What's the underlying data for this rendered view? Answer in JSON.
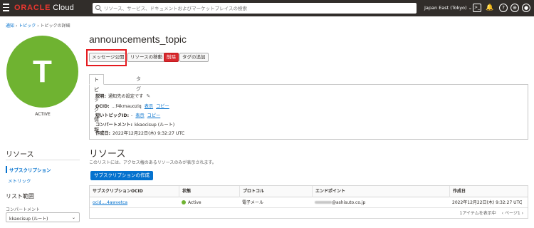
{
  "header": {
    "brand": "ORACLE",
    "product": "Cloud",
    "search_placeholder": "リソース、サービス、ドキュメントおよびマーケットプレイスの検索",
    "region": "Japan East (Tokyo)",
    "region_chevron": "⌄"
  },
  "breadcrumb": {
    "items": [
      "通知",
      "トピック",
      "トピックの詳細"
    ],
    "sep": "›"
  },
  "avatar": {
    "letter": "T",
    "status": "ACTIVE",
    "color": "#6fb331"
  },
  "left_nav": {
    "heading": "リソース",
    "items": [
      "サブスクリプション",
      "メトリック"
    ],
    "scope_heading": "リスト範囲",
    "compartment_label": "コンパートメント",
    "compartment_value": "kkaocisup (ルート)",
    "compartment_chevron": "⌄"
  },
  "main": {
    "title": "announcements_topic",
    "actions": {
      "publish": "メッセージ公開",
      "move": "リソースの移動",
      "delete": "削除",
      "add_tag": "タグの追加"
    },
    "tabs": [
      "トピック情報",
      "タグ"
    ],
    "info": {
      "desc_label": "説明:",
      "desc_value": "通知先の設定です",
      "ocid_label": "OCID:",
      "ocid_value": "...f4kmauoziq",
      "show": "表示",
      "copy": "コピー",
      "short_ocid_label": "短いトピックID:",
      "short_ocid_value": "-",
      "compartment_label": "コンパートメント:",
      "compartment_value": "kkaocisup (ルート)",
      "created_label": "作成日:",
      "created_value": "2022年12月22日(木) 9:32:27 UTC"
    },
    "resources_title": "リソース",
    "resources_desc": "このリストには、アクセス権のあるリソースのみが表示されます。",
    "create_button": "サブスクリプションの作成",
    "table": {
      "headers": [
        "サブスクリプションOCID",
        "状態",
        "プロトコル",
        "エンドポイント",
        "作成日"
      ],
      "rows": [
        {
          "ocid": "ocid....4awvetca",
          "status": "Active",
          "protocol": "電子メール",
          "endpoint_suffix": "@ashisuto.co.jp",
          "created": "2022年12月22日(木) 9:32:27 UTC"
        }
      ],
      "kebab": "⋮"
    },
    "pager": {
      "summary": "1アイテムを表示中",
      "prev": "‹ ページ1",
      "next": "›"
    }
  },
  "status_colors": {
    "active": "#6fb331",
    "danger": "#d7282d",
    "link": "#0572ce"
  }
}
